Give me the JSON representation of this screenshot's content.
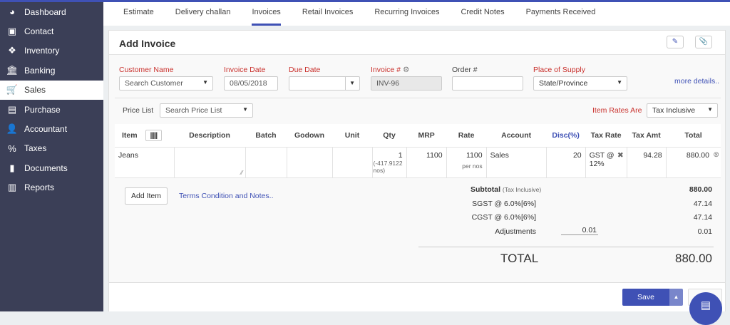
{
  "sidebar": {
    "items": [
      {
        "label": "Dashboard",
        "icon": "dashboard-icon"
      },
      {
        "label": "Contact",
        "icon": "contact-icon"
      },
      {
        "label": "Inventory",
        "icon": "inventory-icon"
      },
      {
        "label": "Banking",
        "icon": "bank-icon"
      },
      {
        "label": "Sales",
        "icon": "cart-icon"
      },
      {
        "label": "Purchase",
        "icon": "bag-icon"
      },
      {
        "label": "Accountant",
        "icon": "user-plus-icon"
      },
      {
        "label": "Taxes",
        "icon": "percent-icon"
      },
      {
        "label": "Documents",
        "icon": "document-icon"
      },
      {
        "label": "Reports",
        "icon": "chart-icon"
      }
    ]
  },
  "tabs": [
    "Estimate",
    "Delivery challan",
    "Invoices",
    "Retail Invoices",
    "Recurring Invoices",
    "Credit Notes",
    "Payments Received"
  ],
  "card": {
    "title": "Add Invoice"
  },
  "form": {
    "customer_label": "Customer Name",
    "customer_placeholder": "Search Customer",
    "invoice_date_label": "Invoice Date",
    "invoice_date": "08/05/2018",
    "due_date_label": "Due Date",
    "due_date": "",
    "invoice_no_label": "Invoice #",
    "invoice_no": "INV-96",
    "order_label": "Order #",
    "order_no": "",
    "supply_label": "Place of Supply",
    "supply_value": "State/Province",
    "more_details": "more details..",
    "price_list_label": "Price List",
    "price_list_placeholder": "Search Price List",
    "rates_label": "Item Rates Are",
    "rates_value": "Tax Inclusive"
  },
  "table": {
    "headers": [
      "Item",
      "Description",
      "Batch",
      "Godown",
      "Unit",
      "Qty",
      "MRP",
      "Rate",
      "Account",
      "Disc(%)",
      "Tax Rate",
      "Tax Amt",
      "Total"
    ],
    "rows": [
      {
        "item": "Jeans",
        "description": "",
        "batch": "",
        "godown": "",
        "unit": "",
        "qty": "1",
        "stock": "(-417.9122 nos)",
        "mrp": "1100",
        "rate": "1100",
        "rate_unit": "per nos",
        "account": "Sales",
        "disc": "20",
        "tax_rate": "GST @ 12%",
        "tax_amt": "94.28",
        "total": "880.00"
      }
    ]
  },
  "actions": {
    "add_item": "Add Item",
    "terms": "Terms Condition and Notes..",
    "save": "Save"
  },
  "totals": {
    "subtotal_label": "Subtotal",
    "subtotal_note": "(Tax Inclusive)",
    "subtotal": "880.00",
    "sgst_label": "SGST @ 6.0%[6%]",
    "sgst": "47.14",
    "cgst_label": "CGST @ 6.0%[6%]",
    "cgst": "47.14",
    "adjust_label": "Adjustments",
    "adjust_input": "0.01",
    "adjust": "0.01",
    "total_label": "TOTAL",
    "total": "880.00"
  }
}
